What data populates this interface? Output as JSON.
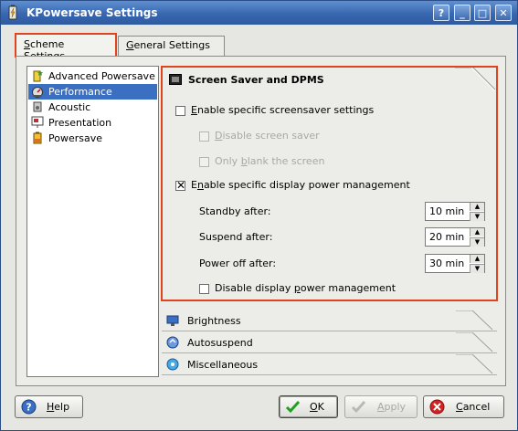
{
  "window": {
    "title": "KPowersave Settings"
  },
  "titlebar_buttons": [
    "?",
    "_",
    "□",
    "✕"
  ],
  "tabs": [
    {
      "label": "Scheme Settings",
      "accel": "S",
      "rest": "cheme Settings",
      "active": true
    },
    {
      "label": "General Settings",
      "accel": "G",
      "rest": "eneral Settings",
      "active": false
    }
  ],
  "schemes": [
    {
      "label": "Advanced Powersave",
      "icon": "battery-star-icon",
      "selected": false
    },
    {
      "label": "Performance",
      "icon": "performance-icon",
      "selected": true
    },
    {
      "label": "Acoustic",
      "icon": "acoustic-icon",
      "selected": false
    },
    {
      "label": "Presentation",
      "icon": "presentation-icon",
      "selected": false
    },
    {
      "label": "Powersave",
      "icon": "battery-icon",
      "selected": false
    }
  ],
  "screensaver": {
    "title": "Screen Saver and DPMS",
    "enable_screensaver": {
      "label_pre": "",
      "accel": "E",
      "label_post": "nable specific screensaver settings",
      "checked": false
    },
    "disable_screensaver": {
      "label_pre": "",
      "accel": "D",
      "label_post": "isable screen saver",
      "checked": false,
      "enabled": false
    },
    "only_blank": {
      "label_pre": "Only ",
      "accel": "b",
      "label_post": "lank the screen",
      "checked": false,
      "enabled": false
    },
    "enable_dpms": {
      "label_pre": "E",
      "accel": "n",
      "label_post": "able specific display power management",
      "checked": true
    },
    "standby_label": "Standby after:",
    "standby_value": "10 min",
    "suspend_label": "Suspend after:",
    "suspend_value": "20 min",
    "poweroff_label": "Power off after:",
    "poweroff_value": "30 min",
    "disable_dpms": {
      "label_pre": "Disable display ",
      "accel": "p",
      "label_post": "ower management",
      "checked": false
    }
  },
  "collapsed_sections": [
    {
      "label": "Brightness",
      "icon": "brightness-monitor-icon"
    },
    {
      "label": "Autosuspend",
      "icon": "autosuspend-icon"
    },
    {
      "label": "Miscellaneous",
      "icon": "miscellaneous-icon"
    }
  ],
  "buttons": {
    "help": {
      "accel": "H",
      "rest": "elp"
    },
    "ok": {
      "accel": "O",
      "rest": "K"
    },
    "apply": {
      "accel": "A",
      "rest": "pply",
      "enabled": false
    },
    "cancel": {
      "accel": "C",
      "rest": "ancel"
    }
  },
  "colors": {
    "highlight": "#e0441c",
    "selection": "#3a6fc2",
    "titlebar": "#3867b0"
  }
}
